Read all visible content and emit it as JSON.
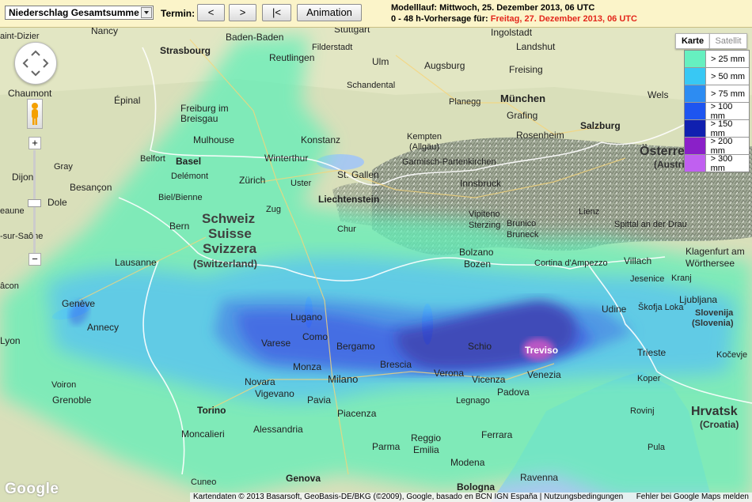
{
  "toolbar": {
    "select_value": "Niederschlag Gesamtsumme",
    "termin_label": "Termin:",
    "buttons": [
      "<",
      ">",
      "|<",
      "Animation"
    ],
    "model_run": "Modelllauf: Mittwoch, 25. Dezember 2013, 06 UTC",
    "forecast_prefix": "0 - 48 h-Vorhersage für: ",
    "forecast_date": "Freitag, 27. Dezember 2013, 06 UTC"
  },
  "maptype": {
    "karte": "Karte",
    "satellit": "Satellit"
  },
  "legend": [
    {
      "label": "> 25 mm",
      "color": "#66f0c0"
    },
    {
      "label": "> 50 mm",
      "color": "#38c8f4"
    },
    {
      "label": "> 75 mm",
      "color": "#2d8cf2"
    },
    {
      "label": "> 100 mm",
      "color": "#1e55f0"
    },
    {
      "label": "> 150 mm",
      "color": "#1020b0"
    },
    {
      "label": "> 200 mm",
      "color": "#8a20c8"
    },
    {
      "label": "> 300 mm",
      "color": "#c060f0"
    }
  ],
  "zoom": {
    "plus": "+",
    "minus": "−"
  },
  "places": {
    "stuttgart": "Stuttgart",
    "baden_baden": "Baden-Baden",
    "nancy": "Nancy",
    "strasbourg": "Strasbourg",
    "reutlingen": "Reutlingen",
    "filderstadt": "Filderstadt",
    "ingolstadt": "Ingolstadt",
    "augsburg": "Augsburg",
    "ulm": "Ulm",
    "landshut": "Landshut",
    "freising": "Freising",
    "muenchen": "München",
    "planegg": "Planegg",
    "grafing": "Grafing",
    "rosenheim": "Rosenheim",
    "schandental": "Schandental",
    "salzburg": "Salzburg",
    "chaumont": "Chaumont",
    "epinal": "Épinal",
    "freiburg": "Freiburg im",
    "breisgau": "Breisgau",
    "mulhouse": "Mulhouse",
    "basel": "Basel",
    "konstanz": "Konstanz",
    "kempten": "Kempten",
    "allgaeu": "(Allgäu)",
    "garmisch": "Garmisch-Partenkirchen",
    "wels": "Wels",
    "oesterreich": "Österreich",
    "austria": "(Austria)",
    "dijon": "Dijon",
    "gray": "Gray",
    "besancon": "Besançon",
    "belfort": "Belfort",
    "delemont": "Delémont",
    "winterthur": "Winterthur",
    "zuerich": "Zürich",
    "ster": "Uster",
    "st_gallen": "St. Gallen",
    "liechtenstein": "Liechtenstein",
    "innsbruck": "Innsbruck",
    "zug": "Zug",
    "dole": "Dole",
    "biel": "Biel/Bienne",
    "bern": "Bern",
    "schweiz": "Schweiz",
    "suisse": "Suisse",
    "svizzera": "Svizzera",
    "switzerland": "(Switzerland)",
    "chur": "Chur",
    "vipiteno": "Vipiteno",
    "sterzing": "Sterzing",
    "brunico": "Brunico",
    "bruneck": "Bruneck",
    "lienz": "Lienz",
    "spittal": "Spittal an der Drau",
    "klagenfurt": "Klagenfurt am",
    "woerthersee": "Wörthersee",
    "villach": "Villach",
    "jesenice": "Jesenice",
    "lausanne": "Lausanne",
    "bolzano": "Bolzano",
    "bozen": "Bozen",
    "cortina": "Cortina d'Ampezzo",
    "kranj": "Kranj",
    "ljubljana": "Ljubljana",
    "slovenija": "Slovenija",
    "slovenia": "(Slovenia)",
    "geneve": "Genève",
    "annecy": "Annecy",
    "lugano": "Lugano",
    "udine": "Udine",
    "skofja": "Škofja Loka",
    "treviso": "Treviso",
    "schio": "Schio",
    "trieste": "Trieste",
    "kocevje": "Kočevje",
    "lyon": "Lyon",
    "varese": "Varese",
    "como": "Como",
    "bergamo": "Bergamo",
    "brescia": "Brescia",
    "verona": "Verona",
    "vicenza": "Vicenza",
    "venezia": "Venezia",
    "koper": "Koper",
    "monza": "Monza",
    "milano": "Milano",
    "novara": "Novara",
    "vigevano": "Vigevano",
    "padova": "Padova",
    "pavia": "Pavia",
    "legnago": "Legnago",
    "voiron": "Voiron",
    "grenoble": "Grenoble",
    "torino": "Torino",
    "piacenza": "Piacenza",
    "rovinj": "Rovinj",
    "hrvatska": "Hrvatsk",
    "croatia": "(Croatia)",
    "moncalieri": "Moncalieri",
    "alessandria": "Alessandria",
    "reggio": "Reggio",
    "emilia": "Emilia",
    "ferrara": "Ferrara",
    "parma": "Parma",
    "modena": "Modena",
    "genova": "Genova",
    "cuneo": "Cuneo",
    "bologna": "Bologna",
    "ravenna": "Ravenna",
    "pula": "Pula",
    "dizier": "aint-Dizier",
    "saone": "-sur-Saône",
    "eaune": "eaune",
    "acon": "âcon"
  },
  "footer": {
    "attribution": "Kartendaten © 2013 Basarsoft, GeoBasis-DE/BKG (©2009), Google, basado en BCN IGN España",
    "terms": "Nutzungsbedingungen",
    "report": "Fehler bei Google Maps melden"
  },
  "google_logo": "Google"
}
